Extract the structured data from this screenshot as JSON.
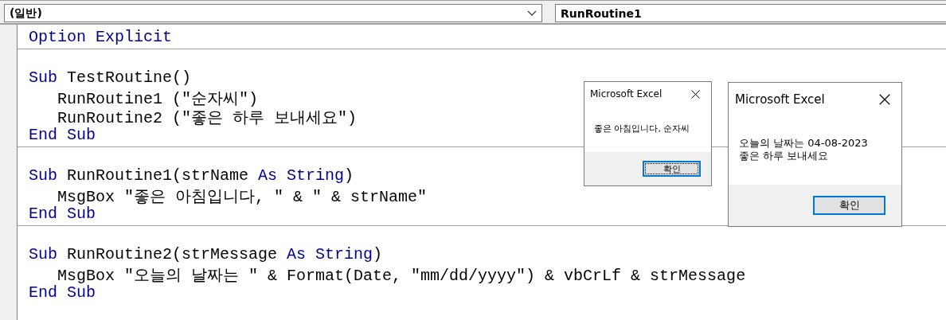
{
  "toolbar": {
    "object_combo": {
      "value": "(일반)"
    },
    "procedure_combo": {
      "value": "RunRoutine1"
    }
  },
  "code": {
    "sections": [
      {
        "lines": [
          [
            {
              "kind": "keyword",
              "text": "Option Explicit"
            }
          ]
        ]
      },
      {
        "lines": [
          [
            {
              "kind": "keyword",
              "text": "Sub"
            },
            {
              "kind": "plain",
              "text": " TestRoutine()"
            }
          ],
          [
            {
              "kind": "plain",
              "text": "   RunRoutine1 (\"순자씨\")"
            }
          ],
          [
            {
              "kind": "plain",
              "text": "   RunRoutine2 (\"좋은 하루 보내세요\")"
            }
          ],
          [
            {
              "kind": "keyword",
              "text": "End Sub"
            }
          ]
        ]
      },
      {
        "lines": [
          [
            {
              "kind": "keyword",
              "text": "Sub"
            },
            {
              "kind": "plain",
              "text": " RunRoutine1(strName "
            },
            {
              "kind": "keyword",
              "text": "As String"
            },
            {
              "kind": "plain",
              "text": ")"
            }
          ],
          [
            {
              "kind": "plain",
              "text": "   MsgBox \"좋은 아침입니다, \" & \" & strName\""
            }
          ],
          [
            {
              "kind": "keyword",
              "text": "End Sub"
            }
          ]
        ]
      },
      {
        "lines": [
          [
            {
              "kind": "keyword",
              "text": "Sub"
            },
            {
              "kind": "plain",
              "text": " RunRoutine2(strMessage "
            },
            {
              "kind": "keyword",
              "text": "As String"
            },
            {
              "kind": "plain",
              "text": ")"
            }
          ],
          [
            {
              "kind": "plain",
              "text": "   MsgBox \"오늘의 날짜는 \" & Format(Date, \"mm/dd/yyyy\") & vbCrLf & strMessage"
            }
          ],
          [
            {
              "kind": "keyword",
              "text": "End Sub"
            }
          ]
        ]
      }
    ]
  },
  "dialogs": [
    {
      "title": "Microsoft Excel",
      "message": "좋은 아침입니다, 순자씨",
      "button": "확인"
    },
    {
      "title": "Microsoft Excel",
      "message": "오늘의 날짜는 04-08-2023\n좋은 하루 보내세요",
      "button": "확인"
    }
  ]
}
